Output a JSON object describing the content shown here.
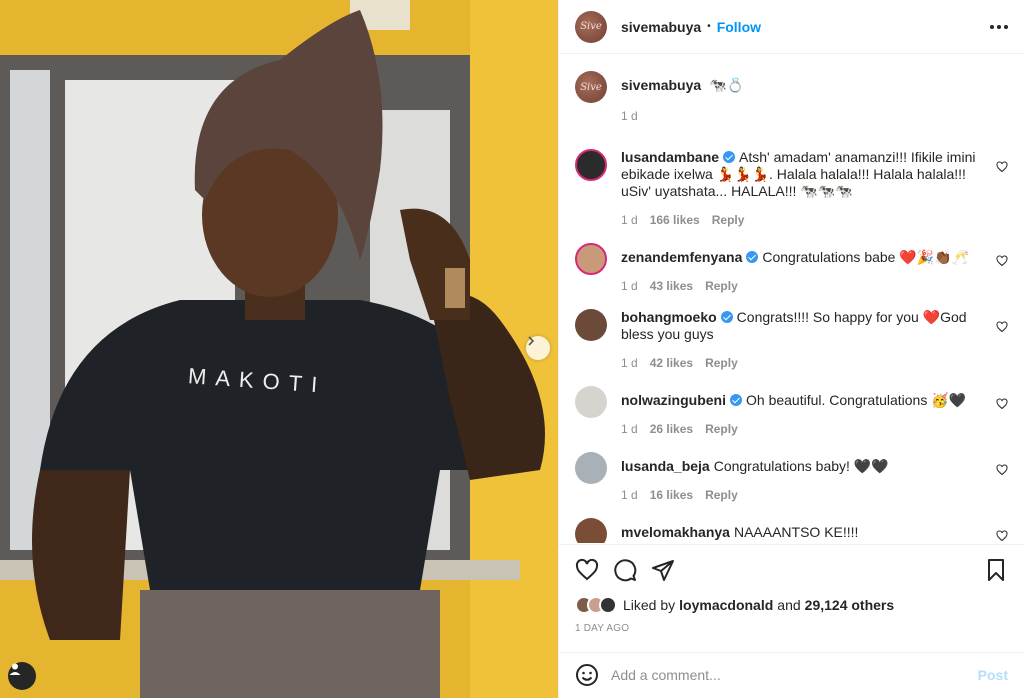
{
  "post": {
    "username": "sivemabuya",
    "follow_label": "Follow",
    "dot": "•",
    "avatar_text": "Sive"
  },
  "photo": {
    "shirt_text": "MAKOTI"
  },
  "caption": {
    "username": "sivemabuya",
    "text": "🐄💍",
    "time": "1 d"
  },
  "comments": [
    {
      "username": "lusandambane",
      "verified": true,
      "text": "Atsh' amadam' anamanzi!!! Ifikile imini ebikade ixelwa 💃💃💃. Halala halala!!! Halala halala!!! uSiv' uyatshata... HALALA!!! 🐄🐄🐄",
      "time": "1 d",
      "likes": "166 likes",
      "reply": "Reply"
    },
    {
      "username": "zenandemfenyana",
      "verified": true,
      "text": "Congratulations babe ❤️🎉👏🏾🥂",
      "time": "1 d",
      "likes": "43 likes",
      "reply": "Reply"
    },
    {
      "username": "bohangmoeko",
      "verified": true,
      "text": "Congrats!!!! So happy for you ❤️God bless you guys",
      "time": "1 d",
      "likes": "42 likes",
      "reply": "Reply"
    },
    {
      "username": "nolwazingubeni",
      "verified": true,
      "text": "Oh beautiful. Congratulations 🥳🖤",
      "time": "1 d",
      "likes": "26 likes",
      "reply": "Reply"
    },
    {
      "username": "lusanda_beja",
      "verified": false,
      "text": "Congratulations baby! 🖤🖤",
      "time": "1 d",
      "likes": "16 likes",
      "reply": "Reply"
    },
    {
      "username": "mvelomakhanya",
      "verified": false,
      "text": "NAAAANTSO KE!!!! CONGRATULATIONS",
      "time": "",
      "likes": "",
      "reply": ""
    }
  ],
  "likes": {
    "prefix": "Liked by ",
    "user": "loymacdonald",
    "middle": " and ",
    "count": "29,124 others"
  },
  "timestamp": "1 DAY AGO",
  "add_comment": {
    "placeholder": "Add a comment...",
    "post_label": "Post"
  },
  "colors": {
    "accent": "#0095f6",
    "post_disabled": "#b2dffc",
    "wall": "#e9b830",
    "heart_red": "#ed4956"
  },
  "icons": {
    "header": [
      "more-icon"
    ],
    "actions": [
      "heart-icon",
      "comment-icon",
      "share-icon",
      "bookmark-icon"
    ],
    "photo": [
      "chevron-right-icon",
      "user-tag-icon"
    ],
    "composer": [
      "emoji-icon"
    ]
  }
}
